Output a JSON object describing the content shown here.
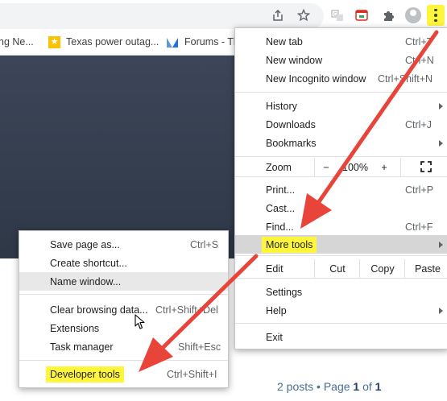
{
  "toolbar": {
    "icons": [
      "share-icon",
      "bookmark-star-icon",
      "translate-icon",
      "extension-red-icon",
      "puzzle-extensions-icon",
      "profile-avatar-icon",
      "kebab-menu-icon"
    ],
    "highlight_color": "#fff53b"
  },
  "bookmarks": [
    {
      "label": "ng Ne..."
    },
    {
      "label": "Texas power outag..."
    },
    {
      "label": "Forums - Th"
    }
  ],
  "page": {
    "pagination_prefix": "2 posts • Page ",
    "pagination_current": "1",
    "pagination_mid": " of ",
    "pagination_total": "1"
  },
  "main_menu": {
    "new_tab": {
      "label": "New tab",
      "shortcut": "Ctrl+T"
    },
    "new_window": {
      "label": "New window",
      "shortcut": "Ctrl+N"
    },
    "new_incognito": {
      "label": "New Incognito window",
      "shortcut": "Ctrl+Shift+N"
    },
    "history": {
      "label": "History"
    },
    "downloads": {
      "label": "Downloads",
      "shortcut": "Ctrl+J"
    },
    "bookmarks": {
      "label": "Bookmarks"
    },
    "zoom": {
      "label": "Zoom",
      "minus": "−",
      "value": "100%",
      "plus": "+"
    },
    "print": {
      "label": "Print...",
      "shortcut": "Ctrl+P"
    },
    "cast": {
      "label": "Cast..."
    },
    "find": {
      "label": "Find...",
      "shortcut": "Ctrl+F"
    },
    "more_tools": {
      "label": "More tools"
    },
    "edit": {
      "label": "Edit",
      "cut": "Cut",
      "copy": "Copy",
      "paste": "Paste"
    },
    "settings": {
      "label": "Settings"
    },
    "help": {
      "label": "Help"
    },
    "exit": {
      "label": "Exit"
    }
  },
  "more_tools_menu": {
    "save_page": {
      "label": "Save page as...",
      "shortcut": "Ctrl+S"
    },
    "create_shortcut": {
      "label": "Create shortcut..."
    },
    "name_window": {
      "label": "Name window..."
    },
    "clear_browsing": {
      "label": "Clear browsing data...",
      "shortcut": "Ctrl+Shift+Del"
    },
    "extensions": {
      "label": "Extensions"
    },
    "task_manager": {
      "label": "Task manager",
      "shortcut": "Shift+Esc"
    },
    "developer_tools": {
      "label": "Developer tools",
      "shortcut": "Ctrl+Shift+I"
    }
  },
  "annotation_color": "#e8443a"
}
